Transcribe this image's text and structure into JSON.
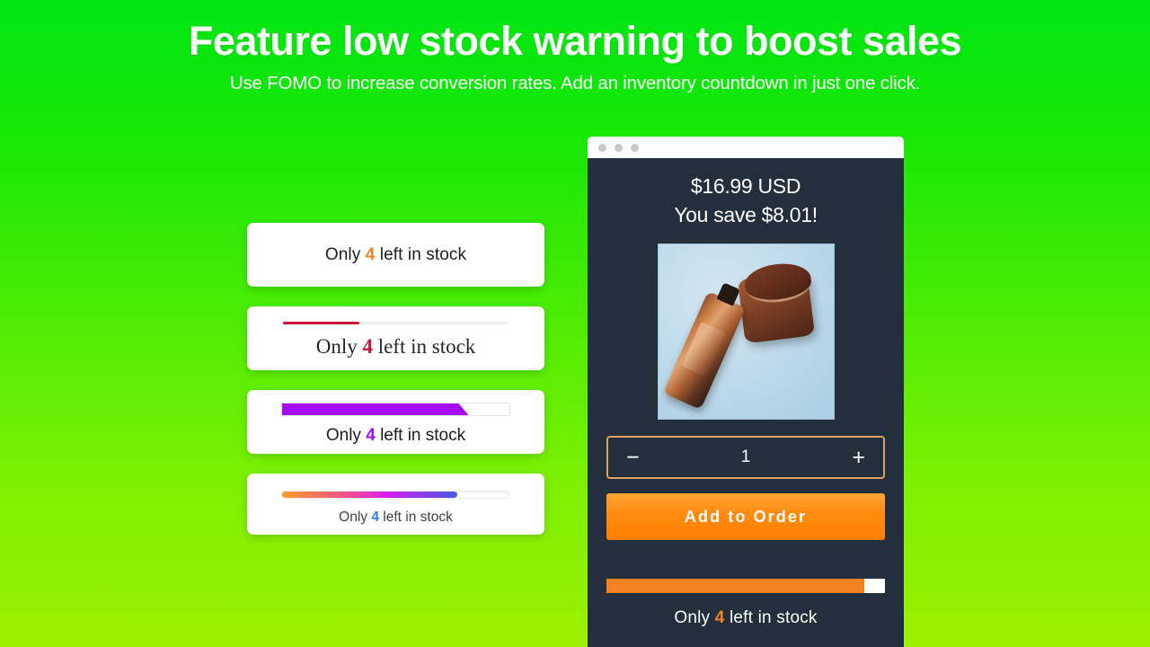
{
  "header": {
    "headline": "Feature low stock warning to boost sales",
    "subhead": "Use FOMO to increase conversion rates. Add an inventory countdown in just one click."
  },
  "widgets": [
    {
      "prefix": "Only ",
      "count": "4",
      "suffix": " left in stock",
      "accent": "#f58220",
      "style": "plain-sans"
    },
    {
      "prefix": "Only ",
      "count": "4",
      "suffix": " left in stock",
      "accent": "#c8173f",
      "style": "serif-thin-bar",
      "bar_percent": 34
    },
    {
      "prefix": "Only ",
      "count": "4",
      "suffix": " left in stock",
      "accent": "#a50bf5",
      "style": "slanted-bar",
      "bar_percent": 82
    },
    {
      "prefix": "Only ",
      "count": "4",
      "suffix": " left in stock",
      "accent": "#2d7ff0",
      "style": "gradient-rounded-bar",
      "bar_percent": 77
    }
  ],
  "mockup": {
    "price": "$16.99 USD",
    "save": "You save $8.01!",
    "quantity": {
      "decrement": "−",
      "value": "1",
      "increment": "+"
    },
    "cta_label": "Add to Order",
    "stock": {
      "bar_percent": 92.5,
      "prefix": "Only ",
      "count": "4",
      "suffix": " left in stock",
      "accent": "#f58220"
    }
  }
}
